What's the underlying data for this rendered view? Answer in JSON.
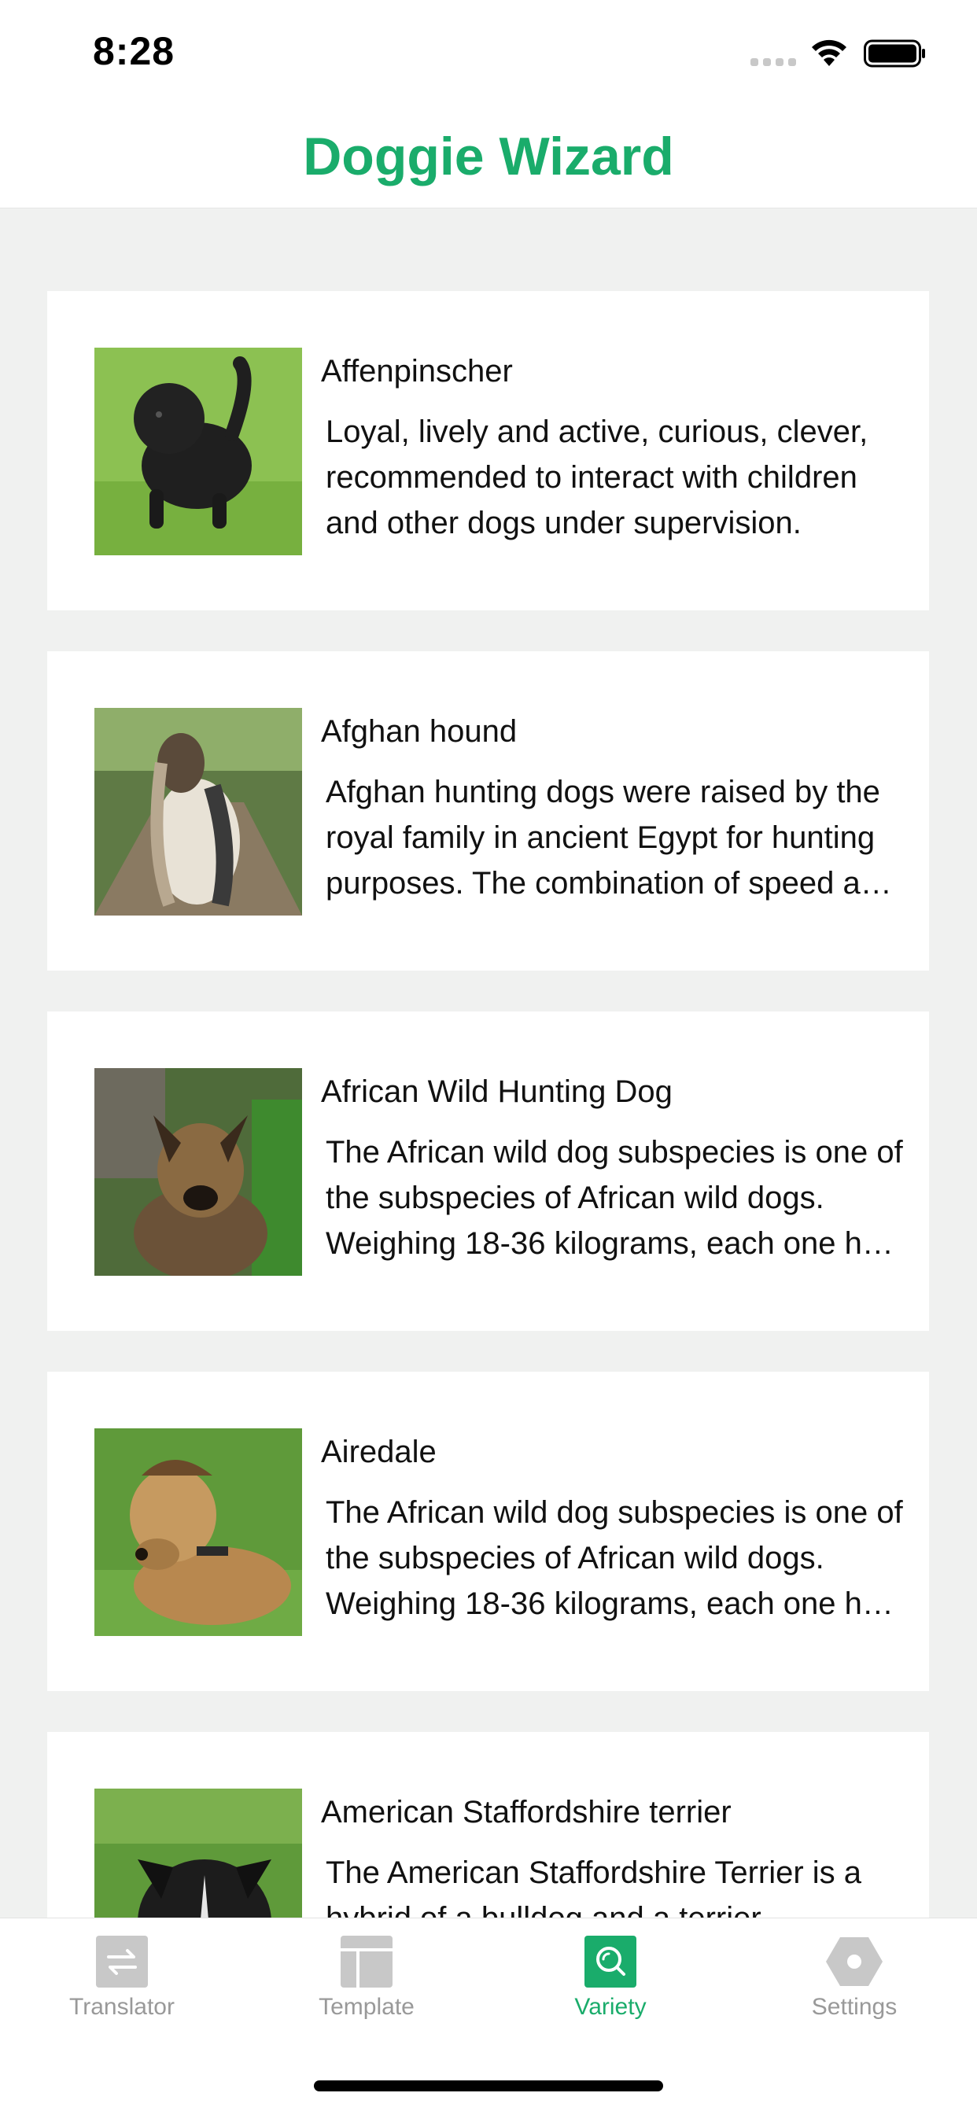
{
  "status_bar": {
    "time": "8:28"
  },
  "header": {
    "title": "Doggie Wizard"
  },
  "breeds": [
    {
      "name": "Affenpinscher",
      "description": "Loyal, lively and active, curious, clever, recommended to interact with children and other dogs under supervision.",
      "thumbnail": "black-terrier-on-grass"
    },
    {
      "name": "Afghan hound",
      "description": "Afghan hunting dogs were raised by the royal family in ancient Egypt for hunting purposes. The combination of speed and stamina makes them excellent hunters.",
      "thumbnail": "long-haired-hound-on-path"
    },
    {
      "name": "African Wild Hunting Dog",
      "description": "The African wild dog subspecies is one of the subspecies of African wild dogs. Weighing 18-36 kilograms, each one has a unique coat pattern.",
      "thumbnail": "wild-dog-in-grass"
    },
    {
      "name": "Airedale",
      "description": "The African wild dog subspecies is one of the subspecies of African wild dogs. Weighing 18-36 kilograms, each one has a unique coat pattern.",
      "thumbnail": "airedale-lying-on-lawn"
    },
    {
      "name": "American Staffordshire terrier",
      "description": "The American Staffordshire Terrier is a hybrid of a bulldog and a terrier.",
      "thumbnail": "black-terrier-head"
    }
  ],
  "tabs": [
    {
      "label": "Translator",
      "icon": "swap-arrows-icon",
      "active": false
    },
    {
      "label": "Template",
      "icon": "template-icon",
      "active": false
    },
    {
      "label": "Variety",
      "icon": "search-icon",
      "active": true
    },
    {
      "label": "Settings",
      "icon": "gear-icon",
      "active": false
    }
  ],
  "colors": {
    "accent": "#1aac6b",
    "inactive": "#999999",
    "background": "#f0f1f0"
  }
}
